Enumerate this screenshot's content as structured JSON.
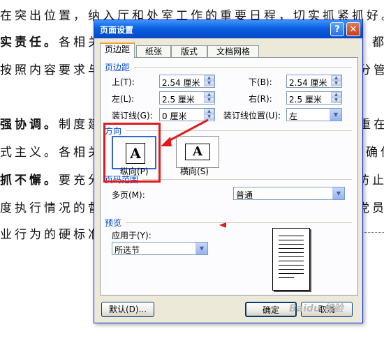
{
  "document": {
    "lines": [
      {
        "text": "在突出位置，纳入厅和处室工作的重要日程，切实抓紧抓好。",
        "bold": ""
      },
      {
        "text": "各相关",
        "bold": "实责任。",
        "right": "，都"
      },
      {
        "text": "按照内容要求与",
        "bold": "",
        "right": "分管"
      },
      {
        "text": "制度建",
        "bold": "强协调。",
        "right": "重在"
      },
      {
        "text": "式主义。各相关",
        "bold": "",
        "right": "确保"
      },
      {
        "text": "要充分",
        "bold": "抓不懈。",
        "right": "防止"
      },
      {
        "text": "度执行情况的督",
        "bold": "",
        "right": "党员"
      },
      {
        "text": "业行为的硬标准",
        "bold": "",
        "right": ""
      }
    ]
  },
  "dialog": {
    "title": "页面设置",
    "help_label": "?",
    "close_label": "✕",
    "tabs": [
      "页边距",
      "纸张",
      "版式",
      "文档网格"
    ],
    "active_tab": "页边距",
    "margins": {
      "group_label": "页边距",
      "top_label": "上(T):",
      "top_value": "2.54 厘米",
      "bottom_label": "下(B):",
      "bottom_value": "2.54 厘米",
      "left_label": "左(L):",
      "left_value": "2.5 厘米",
      "right_label": "右(R):",
      "right_value": "2.5 厘米",
      "gutter_label": "装订线(G):",
      "gutter_value": "0 厘米",
      "gutter_pos_label": "装订线位置(U):",
      "gutter_pos_value": "左"
    },
    "orientation": {
      "group_label": "方向",
      "portrait_label": "纵向(P)",
      "landscape_label": "横向(S)",
      "page_glyph": "A",
      "selected": "portrait"
    },
    "pages": {
      "group_label": "页码范围",
      "multiple_label": "多页(M):",
      "multiple_value": "普通"
    },
    "preview": {
      "group_label": "预览",
      "apply_label": "应用于(Y):",
      "apply_value": "所选节"
    },
    "buttons": {
      "default": "默认(D)...",
      "ok": "确定",
      "cancel": "取消"
    }
  },
  "watermark": "Baidu 经验",
  "colors": {
    "annotation_red": "#e11a1a",
    "title_bar": "#0a5fe0",
    "group_label": "#0046d5"
  }
}
